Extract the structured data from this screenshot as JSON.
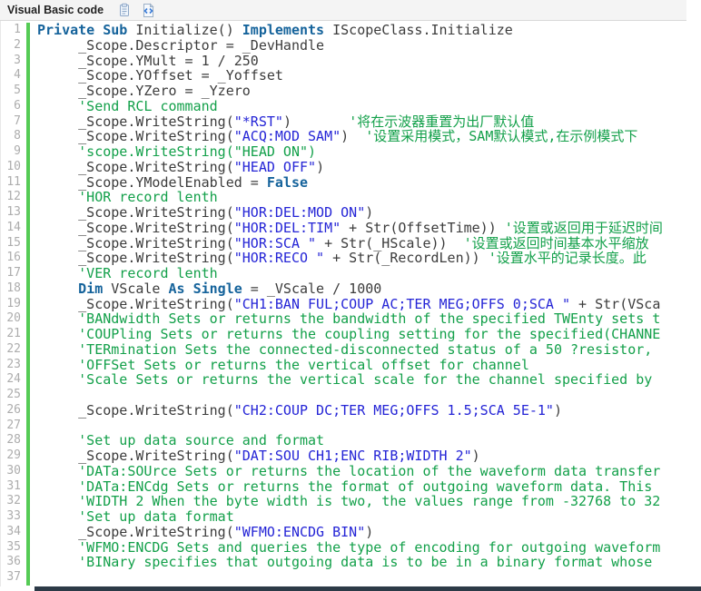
{
  "header": {
    "title": "Visual Basic code",
    "copy_icon": "copy-icon",
    "code_icon": "code-view-icon"
  },
  "colors": {
    "keyword": "#15639b",
    "string": "#2424d6",
    "comment": "#13a04a",
    "plain": "#3c3c3c",
    "gutter_bar": "#55cb55",
    "line_number": "#adadad",
    "header_bg": "#f4f4f4",
    "scrollbar": "#2c3a47"
  },
  "code": {
    "language": "Visual Basic",
    "lines": [
      {
        "n": 1,
        "segs": [
          [
            "k",
            "Private Sub "
          ],
          [
            "p",
            "Initialize() "
          ],
          [
            "k",
            "Implements "
          ],
          [
            "p",
            "IScopeClass.Initialize"
          ]
        ]
      },
      {
        "n": 2,
        "segs": [
          [
            "p",
            "     _Scope.Descriptor = _DevHandle"
          ]
        ]
      },
      {
        "n": 3,
        "segs": [
          [
            "p",
            "     _Scope.YMult = 1 / 250"
          ]
        ]
      },
      {
        "n": 4,
        "segs": [
          [
            "p",
            "     _Scope.YOffset = _Yoffset"
          ]
        ]
      },
      {
        "n": 5,
        "segs": [
          [
            "p",
            "     _Scope.YZero = _Yzero"
          ]
        ]
      },
      {
        "n": 6,
        "segs": [
          [
            "c",
            "     'Send RCL command"
          ]
        ]
      },
      {
        "n": 7,
        "segs": [
          [
            "p",
            "     _Scope.WriteString("
          ],
          [
            "s",
            "\"*RST\""
          ],
          [
            "p",
            ")       "
          ],
          [
            "c",
            "'将在示波器重置为出厂默认值"
          ]
        ]
      },
      {
        "n": 8,
        "segs": [
          [
            "p",
            "     _Scope.WriteString("
          ],
          [
            "s",
            "\"ACQ:MOD SAM\""
          ],
          [
            "p",
            ")  "
          ],
          [
            "c",
            "'设置采用模式，SAM默认模式,在示例模式下"
          ]
        ]
      },
      {
        "n": 9,
        "segs": [
          [
            "c",
            "     'scope.WriteString(\"HEAD ON\")"
          ]
        ]
      },
      {
        "n": 10,
        "segs": [
          [
            "p",
            "     _Scope.WriteString("
          ],
          [
            "s",
            "\"HEAD OFF\""
          ],
          [
            "p",
            ")"
          ]
        ]
      },
      {
        "n": 11,
        "segs": [
          [
            "p",
            "     _Scope.YModelEnabled = "
          ],
          [
            "k",
            "False"
          ]
        ]
      },
      {
        "n": 12,
        "segs": [
          [
            "c",
            "     'HOR record lenth"
          ]
        ]
      },
      {
        "n": 13,
        "segs": [
          [
            "p",
            "     _Scope.WriteString("
          ],
          [
            "s",
            "\"HOR:DEL:MOD ON\""
          ],
          [
            "p",
            ")"
          ]
        ]
      },
      {
        "n": 14,
        "segs": [
          [
            "p",
            "     _Scope.WriteString("
          ],
          [
            "s",
            "\"HOR:DEL:TIM\""
          ],
          [
            "p",
            " + Str(OffsetTime)) "
          ],
          [
            "c",
            "'设置或返回用于延迟时间"
          ]
        ]
      },
      {
        "n": 15,
        "segs": [
          [
            "p",
            "     _Scope.WriteString("
          ],
          [
            "s",
            "\"HOR:SCA \""
          ],
          [
            "p",
            " + Str(_HScale))  "
          ],
          [
            "c",
            "'设置或返回时间基本水平缩放"
          ]
        ]
      },
      {
        "n": 16,
        "segs": [
          [
            "p",
            "     _Scope.WriteString("
          ],
          [
            "s",
            "\"HOR:RECO \""
          ],
          [
            "p",
            " + Str(_RecordLen)) "
          ],
          [
            "c",
            "'设置水平的记录长度。此"
          ]
        ]
      },
      {
        "n": 17,
        "segs": [
          [
            "c",
            "     'VER record lenth"
          ]
        ]
      },
      {
        "n": 18,
        "segs": [
          [
            "p",
            "     "
          ],
          [
            "k",
            "Dim"
          ],
          [
            "p",
            " VScale "
          ],
          [
            "k",
            "As Single"
          ],
          [
            "p",
            " = _VScale / 1000"
          ]
        ]
      },
      {
        "n": 19,
        "segs": [
          [
            "p",
            "     _Scope.WriteString("
          ],
          [
            "s",
            "\"CH1:BAN FUL;COUP AC;TER MEG;OFFS 0;SCA \""
          ],
          [
            "p",
            " + Str(VSca"
          ]
        ]
      },
      {
        "n": 20,
        "segs": [
          [
            "c",
            "     'BANdwidth Sets or returns the bandwidth of the specified TWEnty sets t"
          ]
        ]
      },
      {
        "n": 21,
        "segs": [
          [
            "c",
            "     'COUPling Sets or returns the coupling setting for the specified(CHANNE"
          ]
        ]
      },
      {
        "n": 22,
        "segs": [
          [
            "c",
            "     'TERmination Sets the connected-disconnected status of a 50 ?resistor,"
          ]
        ]
      },
      {
        "n": 23,
        "segs": [
          [
            "c",
            "     'OFFSet Sets or returns the vertical offset for channel"
          ]
        ]
      },
      {
        "n": 24,
        "segs": [
          [
            "c",
            "     'Scale Sets or returns the vertical scale for the channel specified by"
          ]
        ]
      },
      {
        "n": 25,
        "segs": []
      },
      {
        "n": 26,
        "segs": [
          [
            "p",
            "     _Scope.WriteString("
          ],
          [
            "s",
            "\"CH2:COUP DC;TER MEG;OFFS 1.5;SCA 5E-1\""
          ],
          [
            "p",
            ")"
          ]
        ]
      },
      {
        "n": 27,
        "segs": []
      },
      {
        "n": 28,
        "segs": [
          [
            "c",
            "     'Set up data source and format"
          ]
        ]
      },
      {
        "n": 29,
        "segs": [
          [
            "p",
            "     _Scope.WriteString("
          ],
          [
            "s",
            "\"DAT:SOU CH1;ENC RIB;WIDTH 2\""
          ],
          [
            "p",
            ")"
          ]
        ]
      },
      {
        "n": 30,
        "segs": [
          [
            "c",
            "     'DATa:SOUrce Sets or returns the location of the waveform data transfer"
          ]
        ]
      },
      {
        "n": 31,
        "segs": [
          [
            "c",
            "     'DATa:ENCdg Sets or returns the format of outgoing waveform data. This"
          ]
        ]
      },
      {
        "n": 32,
        "segs": [
          [
            "c",
            "     'WIDTH 2 When the byte width is two, the values range from -32768 to 32"
          ]
        ]
      },
      {
        "n": 33,
        "segs": [
          [
            "c",
            "     'Set up data format"
          ]
        ]
      },
      {
        "n": 34,
        "segs": [
          [
            "p",
            "     _Scope.WriteString("
          ],
          [
            "s",
            "\"WFMO:ENCDG BIN\""
          ],
          [
            "p",
            ")"
          ]
        ]
      },
      {
        "n": 35,
        "segs": [
          [
            "c",
            "     'WFMO:ENCDG Sets and queries the type of encoding for outgoing waveform"
          ]
        ]
      },
      {
        "n": 36,
        "segs": [
          [
            "c",
            "     'BINary specifies that outgoing data is to be in a binary format whose"
          ]
        ]
      },
      {
        "n": 37,
        "segs": []
      }
    ]
  }
}
